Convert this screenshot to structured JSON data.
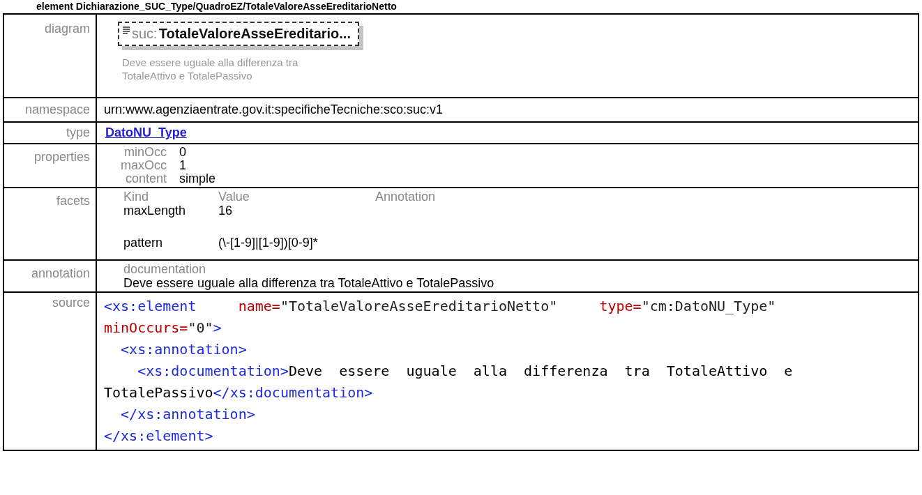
{
  "heading": "element Dichiarazione_SUC_Type/QuadroEZ/TotaleValoreAsseEreditarioNetto",
  "diagram": {
    "label": "diagram",
    "prefix": "suc:",
    "name": "TotaleValoreAsseEreditario...",
    "annotation": "Deve essere uguale alla differenza tra TotaleAttivo e TotalePassivo"
  },
  "namespace": {
    "label": "namespace",
    "value": "urn:www.agenziaentrate.gov.it:specificheTecniche:sco:suc:v1"
  },
  "type": {
    "label": "type",
    "value": "DatoNU_Type"
  },
  "properties": {
    "label": "properties",
    "items": [
      {
        "name": "minOcc",
        "value": "0"
      },
      {
        "name": "maxOcc",
        "value": "1"
      },
      {
        "name": "content",
        "value": "simple"
      }
    ]
  },
  "facets": {
    "label": "facets",
    "columns": [
      "Kind",
      "Value",
      "Annotation"
    ],
    "rows": [
      {
        "kind": "maxLength",
        "value": "16"
      },
      {
        "kind": "pattern",
        "value": "(\\-[1-9]|[1-9])[0-9]*"
      }
    ]
  },
  "annotation": {
    "label": "annotation",
    "title": "documentation",
    "text": "Deve essere uguale alla differenza tra TotaleAttivo e TotalePassivo"
  },
  "source": {
    "label": "source",
    "lines": [
      [
        {
          "kind": "tag",
          "text": "<xs:element"
        },
        {
          "kind": "attr",
          "text": "     name="
        },
        {
          "kind": "value",
          "text": "\"TotaleValoreAsseEreditarioNetto\""
        },
        {
          "kind": "attr",
          "text": "     type="
        },
        {
          "kind": "value",
          "text": "\"cm:DatoNU_Type\""
        }
      ],
      [
        {
          "kind": "attr",
          "text": "minOccurs="
        },
        {
          "kind": "value",
          "text": "\"0\""
        },
        {
          "kind": "tag",
          "text": ">"
        }
      ],
      [
        {
          "kind": "tag",
          "text": "  <xs:annotation>"
        }
      ],
      [
        {
          "kind": "tag",
          "text": "    <xs:documentation>"
        },
        {
          "kind": "text",
          "text": "Deve  essere  uguale  alla  differenza  tra  TotaleAttivo  e"
        }
      ],
      [
        {
          "kind": "text",
          "text": "TotalePassivo"
        },
        {
          "kind": "tag",
          "text": "</xs:documentation>"
        }
      ],
      [
        {
          "kind": "tag",
          "text": "  </xs:annotation>"
        }
      ],
      [
        {
          "kind": "tag",
          "text": "</xs:element>"
        }
      ]
    ]
  }
}
